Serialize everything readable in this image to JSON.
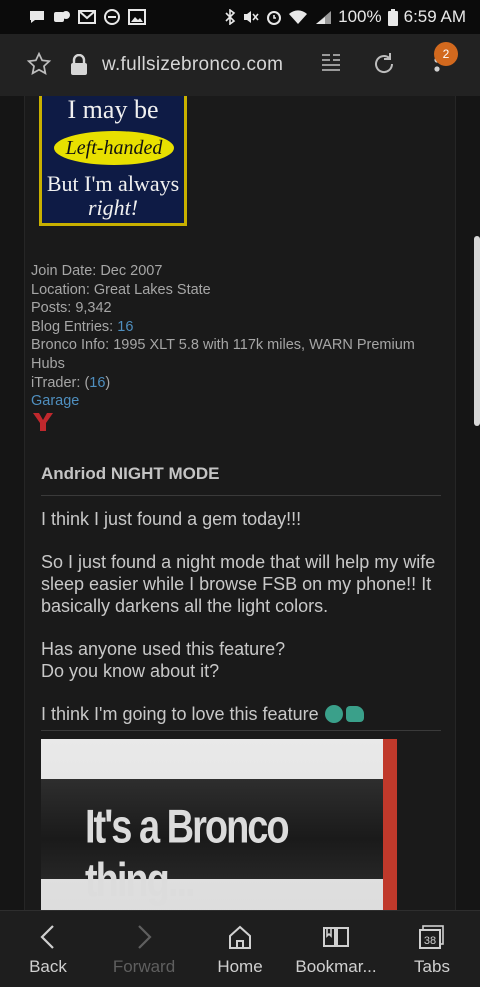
{
  "status_bar": {
    "notification_icons": [
      "message-icon",
      "sync-icon",
      "gmail-icon",
      "minus-circle-icon",
      "image-icon"
    ],
    "battery": "100%",
    "time": "6:59 AM"
  },
  "url_bar": {
    "url": "w.fullsizebronco.com",
    "badge_count": "2"
  },
  "avatar": {
    "line1": "I may be",
    "oval": "Left-handed",
    "line3": "But I'm always",
    "line4": "right!"
  },
  "user_info": {
    "join_date": "Join Date: Dec 2007",
    "location": "Location: Great Lakes State",
    "posts": "Posts: 9,342",
    "blog_label": "Blog Entries: ",
    "blog_count": "16",
    "bronco_line1": "Bronco Info: 1995 XLT 5.8 with 117k miles, WARN Premium",
    "bronco_line2": "Hubs",
    "itrader_label": "iTrader: (",
    "itrader_count": "16",
    "itrader_close": ")",
    "garage": "Garage"
  },
  "post": {
    "title": "Andriod NIGHT MODE",
    "p1": "I think I just found a gem today!!!",
    "p2": "So I just found a night mode that will help my wife sleep easier while I browse FSB on my phone!! It basically darkens all the light colors.",
    "p3a": "Has anyone used this feature?",
    "p3b": "Do you know about it?",
    "p4": "I think I'm going to love this feature",
    "image_text": "It's a Bronco thing..."
  },
  "bottom_nav": {
    "back": "Back",
    "forward": "Forward",
    "home": "Home",
    "bookmarks": "Bookmar...",
    "tabs": "Tabs",
    "tab_count": "38"
  },
  "colors": {
    "link": "#4f8fbf",
    "badge": "#d2691e",
    "avatar_bg": "#0e1b45",
    "avatar_border": "#c8b000"
  }
}
